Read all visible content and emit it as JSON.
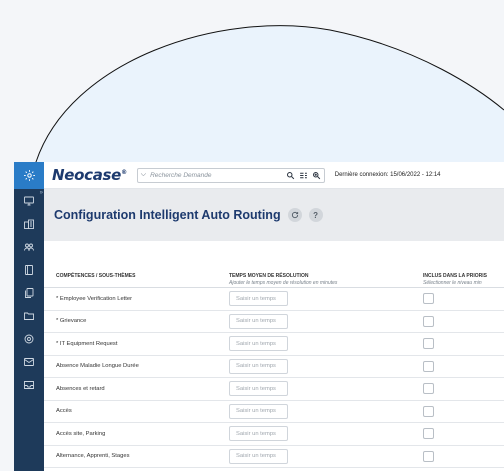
{
  "topbar": {
    "logo": "Neocase",
    "logo_mark": "®",
    "search_placeholder": "Recherche Demande",
    "last_login": "Dernière connexion: 15/06/2022 - 12:14"
  },
  "page": {
    "title": "Configuration Intelligent Auto Routing"
  },
  "table": {
    "columns": [
      {
        "title": "COMPÉTENCES / SOUS-THÈMES",
        "subtitle": ""
      },
      {
        "title": "TEMPS MOYEN DE RÉSOLUTION",
        "subtitle": "Ajouter le temps moyen de résolution en minutes"
      },
      {
        "title": "INCLUS DANS LA PRIORIS",
        "subtitle": "Sélectionner le niveau min"
      }
    ],
    "time_placeholder": "Saisir un temps",
    "rows": [
      {
        "label": "* Employee Verification Letter"
      },
      {
        "label": "* Grievance"
      },
      {
        "label": "* IT Equipment Request"
      },
      {
        "label": "Absence Maladie Longue Durée"
      },
      {
        "label": "Absences et retard"
      },
      {
        "label": "Accès"
      },
      {
        "label": "Accès site, Parking"
      },
      {
        "label": "Alternance, Apprenti, Stages"
      }
    ]
  },
  "colors": {
    "sidebar": "#1e3a5a",
    "sidebar_active": "#2a7cc7",
    "brand": "#1d3a6e",
    "title_band": "#e9ebee"
  }
}
